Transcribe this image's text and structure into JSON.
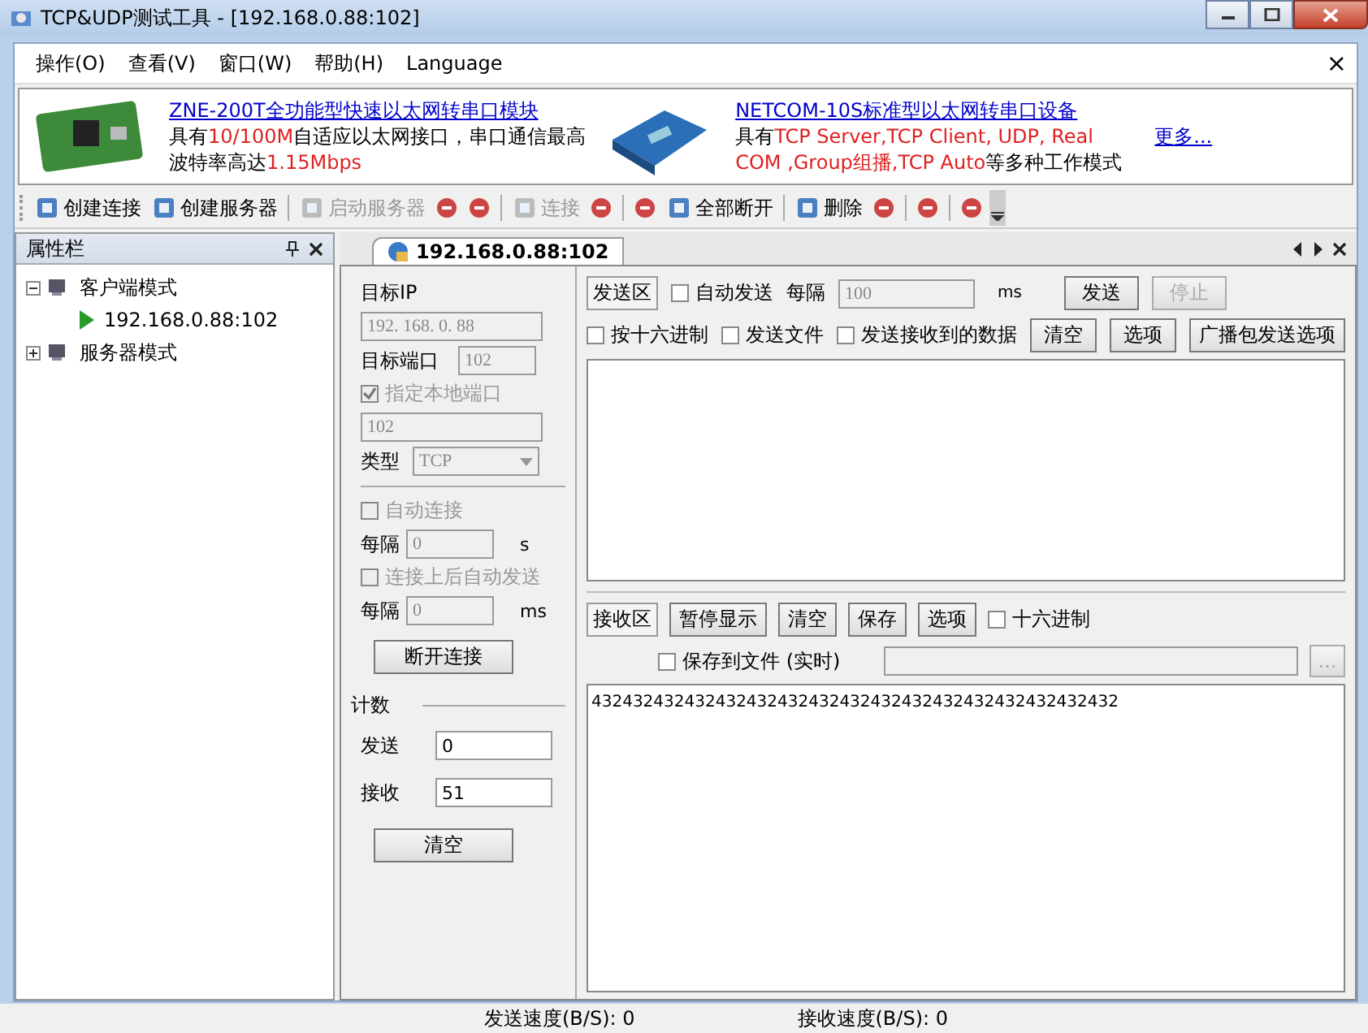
{
  "window": {
    "title": "TCP&UDP测试工具 - [192.168.0.88:102]"
  },
  "menu": {
    "items": [
      {
        "label": "操作(O)"
      },
      {
        "label": "查看(V)"
      },
      {
        "label": "窗口(W)"
      },
      {
        "label": "帮助(H)"
      },
      {
        "label": "Language"
      }
    ],
    "close": "×"
  },
  "ads": [
    {
      "title": "ZNE-200T全功能型快速以太网转串口模块",
      "lines": [
        [
          {
            "text": "具有",
            "highlight": false
          },
          {
            "text": "10/100M",
            "highlight": true
          },
          {
            "text": "自适应以太网接口，串口通信最高",
            "highlight": false
          }
        ],
        [
          {
            "text": "波特率高达",
            "highlight": false
          },
          {
            "text": "1.15Mbps",
            "highlight": true
          }
        ]
      ]
    },
    {
      "title": "NETCOM-10S标准型以太网转串口设备",
      "lines": [
        [
          {
            "text": "具有",
            "highlight": false
          },
          {
            "text": "TCP Server,TCP Client, UDP, Real",
            "highlight": true
          }
        ],
        [
          {
            "text": "COM ,Group组播,TCP Auto",
            "highlight": true
          },
          {
            "text": "等多种工作模式",
            "highlight": false
          }
        ]
      ]
    }
  ],
  "more_link": "更多...",
  "toolbar": [
    {
      "kind": "button",
      "label": "创建连接",
      "disabled": false
    },
    {
      "kind": "button",
      "label": "创建服务器",
      "disabled": false
    },
    {
      "kind": "separator"
    },
    {
      "kind": "button",
      "label": "启动服务器",
      "disabled": true
    },
    {
      "kind": "icon",
      "disabled": false
    },
    {
      "kind": "icon",
      "disabled": false
    },
    {
      "kind": "separator"
    },
    {
      "kind": "button",
      "label": "连接",
      "disabled": true
    },
    {
      "kind": "icon",
      "disabled": false
    },
    {
      "kind": "separator"
    },
    {
      "kind": "icon",
      "disabled": false
    },
    {
      "kind": "button",
      "label": "全部断开",
      "disabled": false
    },
    {
      "kind": "separator"
    },
    {
      "kind": "button",
      "label": "删除",
      "disabled": false
    },
    {
      "kind": "icon",
      "disabled": false
    },
    {
      "kind": "separator"
    },
    {
      "kind": "icon",
      "disabled": false
    },
    {
      "kind": "separator"
    },
    {
      "kind": "icon",
      "disabled": false
    }
  ],
  "sidebar": {
    "title": "属性栏",
    "tree": [
      {
        "label": "客户端模式",
        "expanded": true,
        "children": [
          {
            "label": "192.168.0.88:102",
            "selected": false
          }
        ]
      },
      {
        "label": "服务器模式",
        "expanded": false
      }
    ]
  },
  "tabs": [
    {
      "label": "192.168.0.88:102",
      "selected": true
    }
  ],
  "connection": {
    "target_ip_label": "目标IP",
    "target_ip": "192. 168. 0. 88",
    "target_port_label": "目标端口",
    "target_port": "102",
    "local_port": {
      "label": "指定本地端口",
      "checked": true,
      "disabled": true
    },
    "local_port_value": "102",
    "type_label": "类型",
    "type": "TCP",
    "auto_connect": {
      "label": "自动连接",
      "checked": false,
      "disabled": true
    },
    "interval1_label": "每隔",
    "interval1": "0",
    "interval1_unit": "s",
    "auto_send": {
      "label": "连接上后自动发送",
      "checked": false,
      "disabled": true
    },
    "interval2_label": "每隔",
    "interval2": "0",
    "interval2_unit": "ms",
    "disconnect_button": "断开连接"
  },
  "counter": {
    "title": "计数",
    "sent_label": "发送",
    "sent": "0",
    "received_label": "接收",
    "received": "51",
    "clear_button": "清空"
  },
  "send": {
    "area_label": "发送区",
    "auto_send": {
      "label": "自动发送",
      "checked": false
    },
    "interval_label": "每隔",
    "interval": "100",
    "interval_unit": "ms",
    "send_button": "发送",
    "stop_button": "停止",
    "stop_disabled": true,
    "options": [
      {
        "label": "按十六进制",
        "checked": false
      },
      {
        "label": "发送文件",
        "checked": false
      },
      {
        "label": "发送接收到的数据",
        "checked": false
      }
    ],
    "clear_button": "清空",
    "options_button": "选项",
    "broadcast_button": "广播包发送选项"
  },
  "receive": {
    "area_label": "接收区",
    "buttons": [
      "暂停显示",
      "清空",
      "保存",
      "选项"
    ],
    "hex": {
      "label": "十六进制",
      "checked": false
    },
    "save_to_file": {
      "label": "保存到文件 (实时)",
      "checked": false
    },
    "browse_button": "...",
    "content": "432432432432432432432432432432432432432432432432432"
  },
  "status_bar": [
    "发送速度(B/S): 0",
    "接收速度(B/S): 0"
  ]
}
